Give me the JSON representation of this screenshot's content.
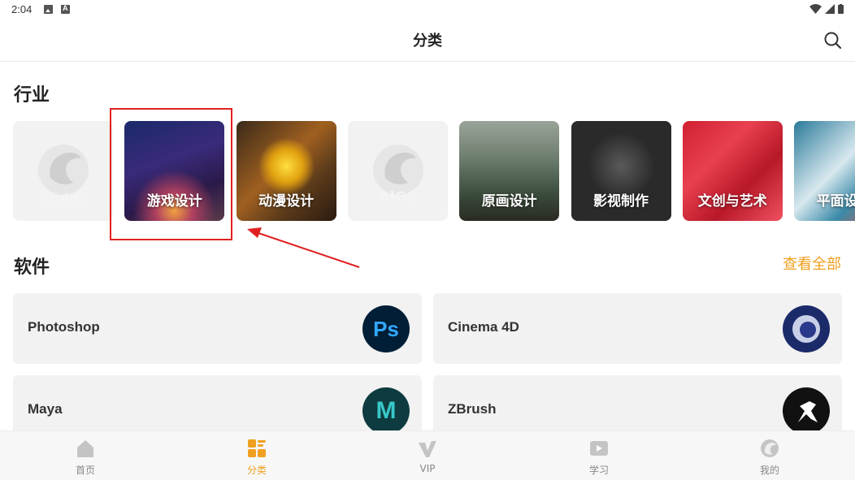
{
  "status_bar": {
    "time": "2:04"
  },
  "header": {
    "title": "分类"
  },
  "sections": {
    "industry_title": "行业",
    "software_title": "软件",
    "see_all": "查看全部"
  },
  "industries": [
    {
      "label": "CG电影",
      "style": "placeholder"
    },
    {
      "label": "游戏设计",
      "style": "game"
    },
    {
      "label": "动漫设计",
      "style": "anime"
    },
    {
      "label": "AIGC",
      "style": "placeholder"
    },
    {
      "label": "原画设计",
      "style": "concept"
    },
    {
      "label": "影视制作",
      "style": "film"
    },
    {
      "label": "文创与艺术",
      "style": "art"
    },
    {
      "label": "平面设计",
      "style": "graphic"
    }
  ],
  "software": [
    {
      "label": "Photoshop",
      "icon": "photoshop-icon",
      "icon_text": "Ps",
      "color": "#001e36",
      "accent": "#31a8ff"
    },
    {
      "label": "Cinema 4D",
      "icon": "cinema4d-icon",
      "icon_text": "",
      "color": "#1b2b6a",
      "accent": "#ffffff"
    },
    {
      "label": "Maya",
      "icon": "maya-icon",
      "icon_text": "M",
      "color": "#0e3b3f",
      "accent": "#37c8c8"
    },
    {
      "label": "ZBrush",
      "icon": "zbrush-icon",
      "icon_text": "",
      "color": "#111111",
      "accent": "#ffffff"
    }
  ],
  "bottom_nav": [
    {
      "label": "首页",
      "icon": "home-icon",
      "active": false
    },
    {
      "label": "分类",
      "icon": "category-icon",
      "active": true
    },
    {
      "label": "VIP",
      "icon": "vip-icon",
      "active": false
    },
    {
      "label": "学习",
      "icon": "learn-icon",
      "active": false
    },
    {
      "label": "我的",
      "icon": "profile-icon",
      "active": false
    }
  ],
  "colors": {
    "accent": "#f0a020",
    "highlight": "#e02020",
    "card_bg": "#f2f2f2"
  }
}
